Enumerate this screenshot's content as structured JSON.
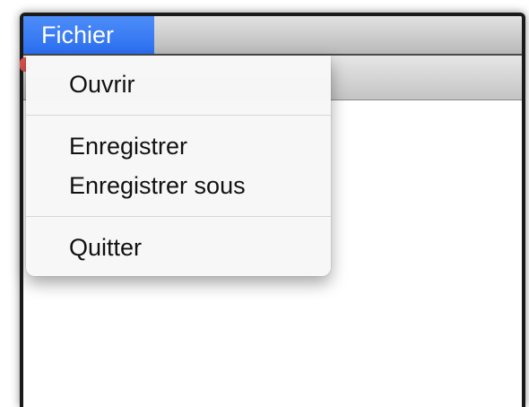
{
  "menubar": {
    "active_menu": "Fichier"
  },
  "menu": {
    "groups": [
      [
        "Ouvrir"
      ],
      [
        "Enregistrer",
        "Enregistrer sous"
      ],
      [
        "Quitter"
      ]
    ]
  },
  "colors": {
    "menu_highlight": "#2a6ef0",
    "menu_background": "#f7f7f7",
    "separator": "#d7d7d7"
  }
}
